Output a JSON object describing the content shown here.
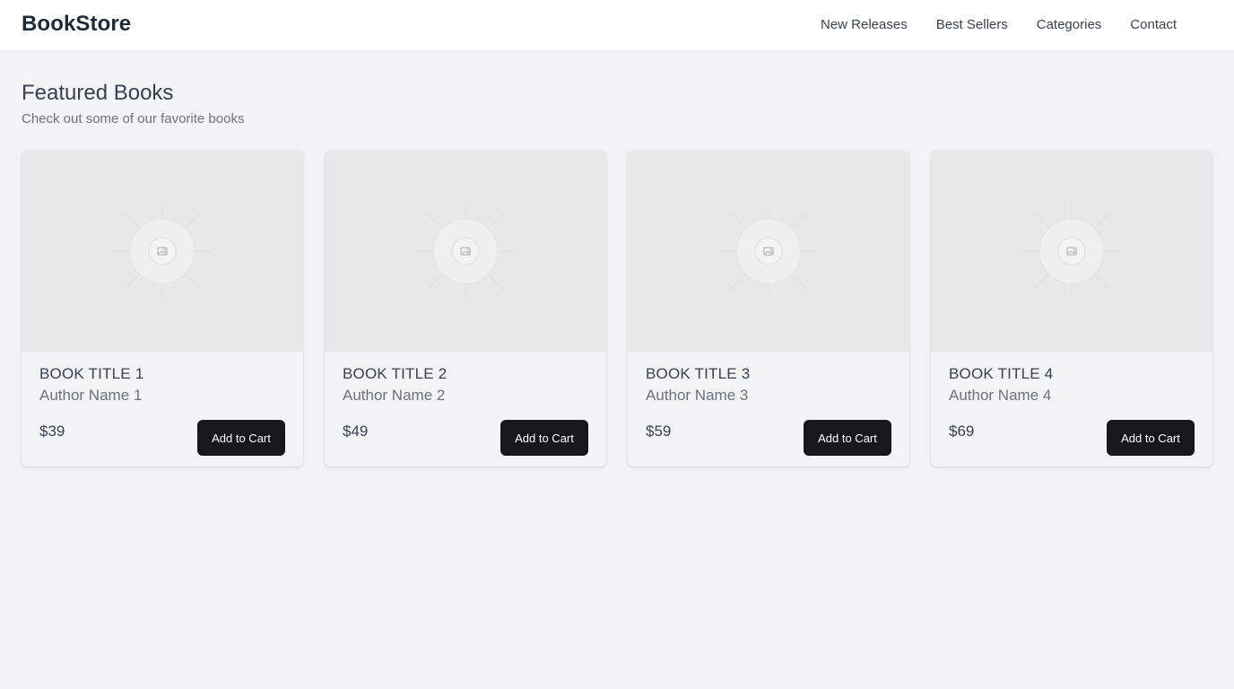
{
  "header": {
    "brand": "BookStore",
    "nav": [
      "New Releases",
      "Best Sellers",
      "Categories",
      "Contact"
    ]
  },
  "section": {
    "title": "Featured Books",
    "subtitle": "Check out some of our favorite books"
  },
  "books": [
    {
      "title": "BOOK TITLE 1",
      "author": "Author Name 1",
      "price": "$39",
      "button": "Add to Cart",
      "image_icon": "image-placeholder-icon"
    },
    {
      "title": "BOOK TITLE 2",
      "author": "Author Name 2",
      "price": "$49",
      "button": "Add to Cart",
      "image_icon": "image-placeholder-icon"
    },
    {
      "title": "BOOK TITLE 3",
      "author": "Author Name 3",
      "price": "$59",
      "button": "Add to Cart",
      "image_icon": "image-placeholder-icon"
    },
    {
      "title": "BOOK TITLE 4",
      "author": "Author Name 4",
      "price": "$69",
      "button": "Add to Cart",
      "image_icon": "image-placeholder-icon"
    }
  ],
  "colors": {
    "page_background": "#f2f3f5",
    "header_background": "#ffffff",
    "image_placeholder": "#e8e8e8",
    "button_background": "#18181b",
    "button_text": "#ffffff"
  }
}
